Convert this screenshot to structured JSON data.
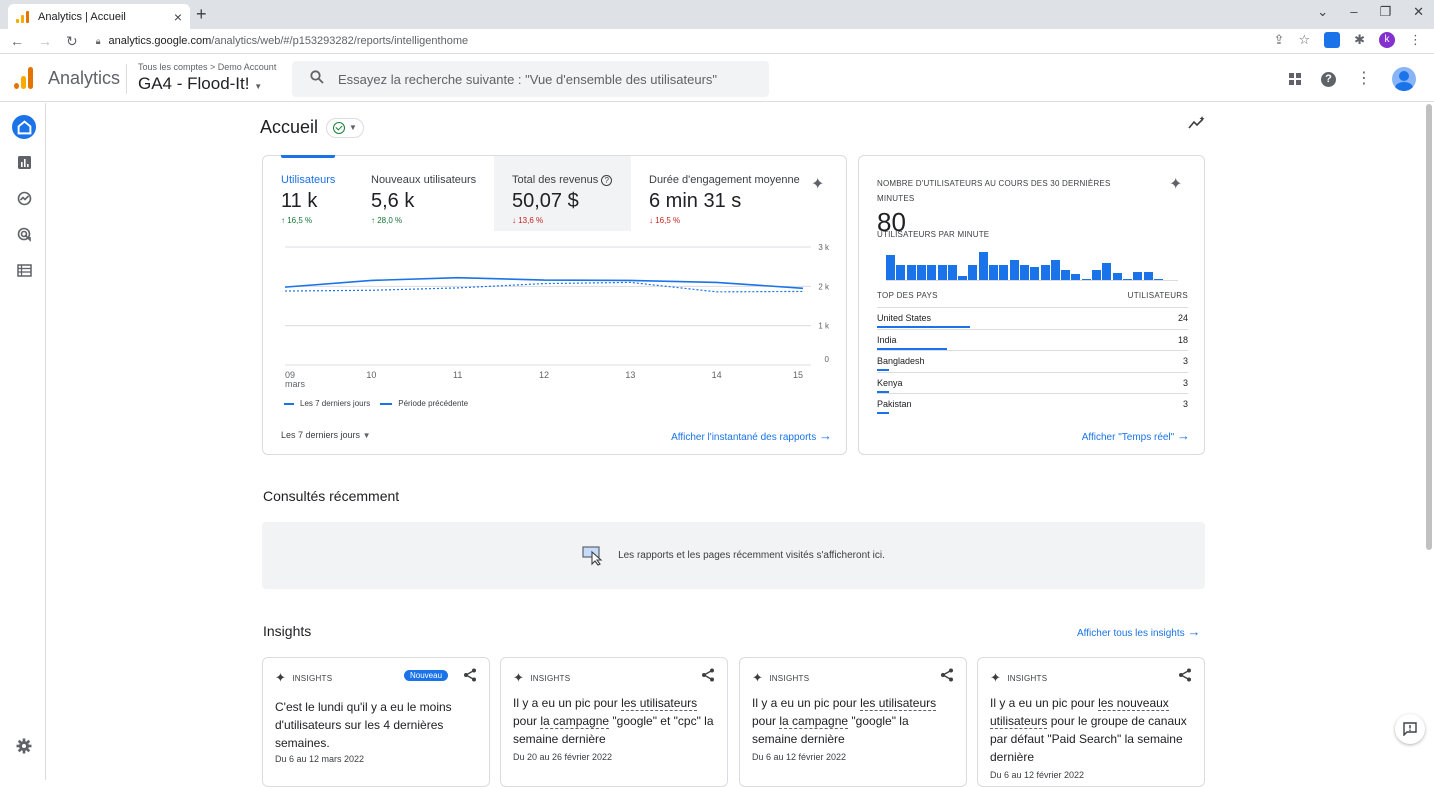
{
  "browser": {
    "tab_title": "Analytics | Accueil",
    "tab_close": "×",
    "new_tab": "+",
    "url_domain": "analytics.google.com",
    "url_path": "/analytics/web/#/p153293282/reports/intelligenthome"
  },
  "header": {
    "app_name": "Analytics",
    "breadcrumb": "Tous les comptes > Demo Account",
    "property": "GA4 - Flood-It!",
    "search_placeholder": "Essayez la recherche suivante : \"Vue d'ensemble des utilisateurs\""
  },
  "page": {
    "title": "Accueil"
  },
  "overview": {
    "metrics": [
      {
        "label": "Utilisateurs",
        "value": "11 k",
        "change": "16,5 %",
        "direction": "up"
      },
      {
        "label": "Nouveaux utilisateurs",
        "value": "5,6 k",
        "change": "28,0 %",
        "direction": "up"
      },
      {
        "label": "Total des revenus",
        "value": "50,07 $",
        "change": "13,6 %",
        "direction": "down"
      },
      {
        "label": "Durée d'engagement moyenne",
        "value": "6 min 31 s",
        "change": "16,5 %",
        "direction": "down"
      }
    ],
    "legend_current": "Les 7 derniers jours",
    "legend_previous": "Période précédente",
    "date_range": "Les 7 derniers jours",
    "snapshot_link": "Afficher l'instantané des rapports"
  },
  "chart_data": {
    "type": "line",
    "x": [
      "09",
      "10",
      "11",
      "12",
      "13",
      "14",
      "15"
    ],
    "x_sublabel": "mars",
    "y_ticks": [
      "0",
      "1 k",
      "2 k",
      "3 k"
    ],
    "ylim": [
      0,
      3000
    ],
    "series": [
      {
        "name": "Les 7 derniers jours",
        "values": [
          1980,
          2150,
          2220,
          2160,
          2150,
          2100,
          1950
        ]
      },
      {
        "name": "Période précédente",
        "values": [
          1880,
          1900,
          1960,
          2070,
          2100,
          1860,
          1870
        ]
      }
    ]
  },
  "realtime": {
    "title": "NOMBRE D'UTILISATEURS AU COURS DES 30 DERNIÈRES MINUTES",
    "value": "80",
    "sublabel": "UTILISATEURS PAR MINUTE",
    "minute_bars": [
      0.9,
      0.55,
      0.55,
      0.55,
      0.55,
      0.55,
      0.55,
      0.15,
      0.55,
      1.0,
      0.55,
      0.55,
      0.7,
      0.55,
      0.45,
      0.55,
      0.7,
      0.35,
      0.2,
      0.05,
      0.35,
      0.6,
      0.25,
      0.05,
      0.3,
      0.3,
      0.05
    ],
    "col_country": "TOP DES PAYS",
    "col_users": "UTILISATEURS",
    "countries": [
      {
        "name": "United States",
        "count": "24",
        "share": 1.0
      },
      {
        "name": "India",
        "count": "18",
        "share": 0.75
      },
      {
        "name": "Bangladesh",
        "count": "3",
        "share": 0.125
      },
      {
        "name": "Kenya",
        "count": "3",
        "share": 0.125
      },
      {
        "name": "Pakistan",
        "count": "3",
        "share": 0.125
      }
    ],
    "link": "Afficher \"Temps réel\""
  },
  "recent": {
    "title": "Consultés récemment",
    "empty_text": "Les rapports et les pages récemment visités s'afficheront ici."
  },
  "insights": {
    "title": "Insights",
    "all_link": "Afficher tous les insights",
    "label": "INSIGHTS",
    "new_badge": "Nouveau",
    "cards": [
      {
        "body": "C'est le lundi qu'il y a eu le moins d'utilisateurs sur les 4 dernières semaines.",
        "date": "Du 6 au 12 mars 2022"
      },
      {
        "body_a": "Il y a eu un pic pour ",
        "body_b": "les utilisateurs",
        "body_c": " pour ",
        "body_d": "la campagne",
        "body_e": " \"google\" et \"cpc\" la semaine dernière",
        "date": "Du 20 au 26 février 2022"
      },
      {
        "body_a": "Il y a eu un pic pour ",
        "body_b": "les utilisateurs",
        "body_c": " pour ",
        "body_d": "la campagne",
        "body_e": " \"google\" la semaine dernière",
        "date": "Du 6 au 12 février 2022"
      },
      {
        "body_a": "Il y a eu un pic pour ",
        "body_b": "les nouveaux utilisateurs",
        "body_c": " pour le groupe de canaux par défaut \"Paid Search\" la semaine dernière",
        "date": "Du 6 au 12 février 2022"
      }
    ]
  },
  "colors": {
    "accent": "#1a73e8",
    "up": "#137333",
    "down": "#c5221f",
    "logo": [
      "#f9ab00",
      "#e37400"
    ]
  }
}
